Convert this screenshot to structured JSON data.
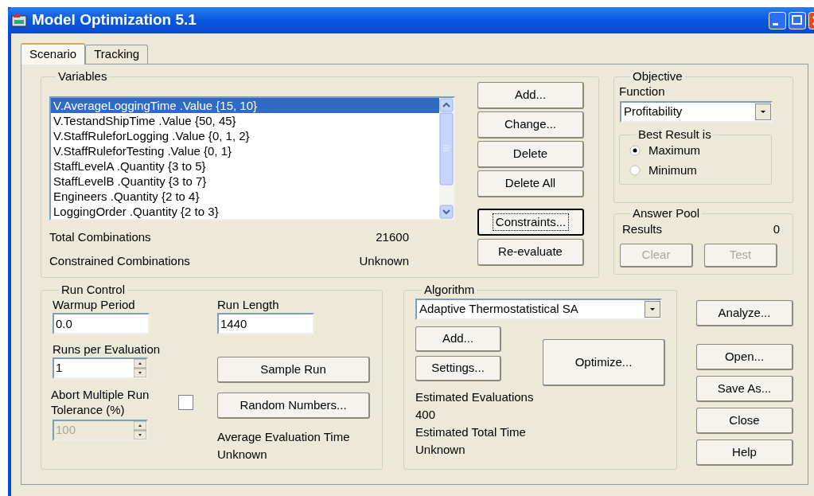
{
  "window": {
    "title": "Model Optimization 5.1"
  },
  "tabs": [
    {
      "label": "Scenario",
      "selected": true
    },
    {
      "label": "Tracking",
      "selected": false
    }
  ],
  "variables": {
    "title": "Variables",
    "items": [
      {
        "label": "V.AverageLoggingTime .Value {15, 10}",
        "selected": true
      },
      {
        "label": "V.TestandShipTime .Value {50, 45}",
        "selected": false
      },
      {
        "label": "V.StaffRuleforLogging .Value {0, 1, 2}",
        "selected": false
      },
      {
        "label": "V.StaffRuleforTesting .Value {0, 1}",
        "selected": false
      },
      {
        "label": "StaffLevelA .Quantity {3 to 5}",
        "selected": false
      },
      {
        "label": "StaffLevelB .Quantity {3 to 7}",
        "selected": false
      },
      {
        "label": "Engineers .Quantity {2 to 4}",
        "selected": false
      },
      {
        "label": "LoggingOrder .Quantity {2 to 3}",
        "selected": false
      }
    ],
    "buttons": [
      {
        "label": "Add...",
        "focused": false
      },
      {
        "label": "Change...",
        "focused": false
      },
      {
        "label": "Delete",
        "focused": false
      },
      {
        "label": "Delete All",
        "focused": false
      }
    ],
    "lower_buttons": [
      {
        "label": "Constraints...",
        "focused": true
      },
      {
        "label": "Re-evaluate",
        "focused": false
      }
    ],
    "stats": [
      {
        "label": "Total Combinations",
        "value": "21600"
      },
      {
        "label": "Constrained Combinations",
        "value": "Unknown"
      }
    ]
  },
  "objective": {
    "title": "Objective",
    "function_label": "Function",
    "function_value": "Profitability",
    "best_result": {
      "title": "Best Result is",
      "options": [
        {
          "label": "Maximum",
          "selected": true
        },
        {
          "label": "Minimum",
          "selected": false
        }
      ]
    }
  },
  "answer_pool": {
    "title": "Answer Pool",
    "results_label": "Results",
    "results_value": "0",
    "buttons": [
      {
        "label": "Clear",
        "disabled": true
      },
      {
        "label": "Test",
        "disabled": true
      }
    ]
  },
  "run_control": {
    "title": "Run Control",
    "warmup": {
      "label": "Warmup Period",
      "value": "0.0"
    },
    "run_length": {
      "label": "Run Length",
      "value": "1440"
    },
    "runs_per_evaluation": {
      "label": "Runs per Evaluation",
      "value": "1"
    },
    "abort": {
      "label": "Abort Multiple Run Tolerance (%)",
      "checked": false,
      "value": "100",
      "disabled": true
    },
    "buttons": [
      "Sample Run",
      "Random Numbers..."
    ],
    "average_label": "Average Evaluation Time",
    "average_value": "Unknown"
  },
  "algorithm": {
    "title": "Algorithm",
    "value": "Adaptive Thermostatistical SA",
    "add": "Add...",
    "settings": "Settings...",
    "optimize": "Optimize...",
    "estimated_evaluations_label": "Estimated Evaluations",
    "estimated_evaluations": "400",
    "estimated_time_label": "Estimated Total Time",
    "estimated_time": "Unknown"
  },
  "side_buttons": [
    "Analyze...",
    "Open...",
    "Save As...",
    "Close",
    "Help"
  ]
}
